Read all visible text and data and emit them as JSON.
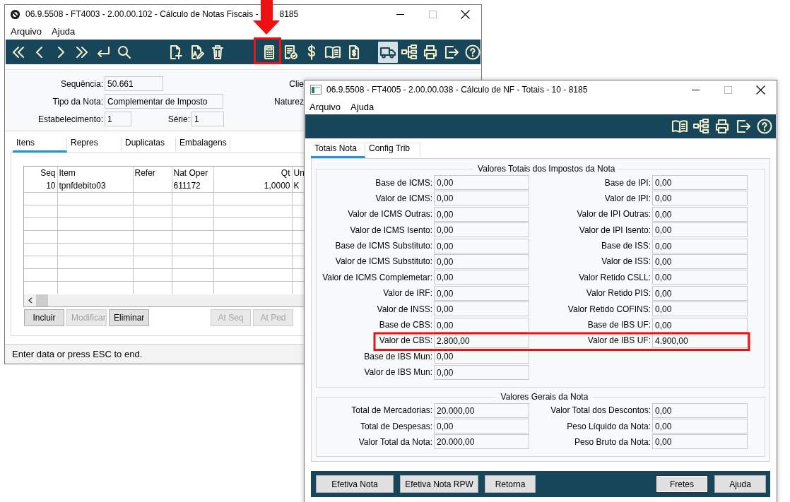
{
  "back_window": {
    "title": "06.9.5508 - FT4003 - 2.00.00.102 - Cálculo de Notas Fiscais -",
    "title_end": "8185",
    "menu": [
      "Arquivo",
      "Ajuda"
    ],
    "toolbar": [
      {
        "pressed": false
      },
      {
        "pressed": false
      },
      {
        "pressed": false
      },
      {
        "pressed": false
      },
      {
        "pressed": false
      },
      {
        "pressed": false
      },
      {
        "pressed": false
      },
      {
        "pressed": false
      },
      {
        "pressed": false
      },
      {
        "pressed": false
      },
      {
        "pressed": false
      },
      {
        "pressed": false
      },
      {
        "pressed": false
      },
      {
        "pressed": false
      },
      {
        "pressed": true
      },
      {
        "pressed": false
      },
      {
        "pressed": false
      },
      {
        "pressed": false
      },
      {
        "pressed": false
      }
    ],
    "form": {
      "sequencia": {
        "label": "Sequência:",
        "value": "50.661"
      },
      "tipo": {
        "label": "Tipo da Nota:",
        "value": "Complementar de Imposto"
      },
      "estabelecimento": {
        "label": "Estabelecimento:",
        "value": "1"
      },
      "serie": {
        "label": "Série:",
        "value": "1"
      },
      "cut_labels": [
        "Clie",
        "Naturez"
      ]
    },
    "tabs": [
      {
        "label": "Itens",
        "selected": true
      },
      {
        "label": "Repres",
        "selected": false
      },
      {
        "label": "Duplicatas",
        "selected": false
      },
      {
        "label": "Embalagens",
        "selected": false
      }
    ],
    "table": {
      "columns": [
        "Seq",
        "Item",
        "Refer",
        "Nat Oper",
        "Qt",
        "Un"
      ],
      "rows": [
        [
          "10",
          "tpnfdebito03",
          null,
          "611172",
          "1,0000",
          "K"
        ]
      ]
    },
    "buttons": [
      {
        "label": "Incluir",
        "disabled": false
      },
      {
        "label": "Modificar",
        "disabled": true
      },
      {
        "label": "Eliminar",
        "disabled": false
      }
    ],
    "buttons_right": [
      {
        "label": "At Seq",
        "disabled": true
      },
      {
        "label": "At Ped",
        "disabled": true
      }
    ],
    "status_bar": "Enter data or press ESC to end."
  },
  "front_window": {
    "title": "06.9.5508 - FT4005 - 2.00.00.038 - Cálculo de NF - Totais - 10 - 8185",
    "menu": [
      "Arquivo",
      "Ajuda"
    ],
    "tabs": [
      {
        "label": "Totais Nota",
        "selected": true
      },
      {
        "label": "Config Trib",
        "selected": false
      }
    ],
    "tax_group": {
      "title": "Valores Totais dos Impostos da Nota",
      "left": [
        {
          "label": "Base de ICMS:",
          "value": "0,00"
        },
        {
          "label": "Valor de ICMS:",
          "value": "0,00"
        },
        {
          "label": "Valor de ICMS Outras:",
          "value": "0,00"
        },
        {
          "label": "Valor de ICMS Isento:",
          "value": "0,00"
        },
        {
          "label": "Base de ICMS Substituto:",
          "value": "0,00"
        },
        {
          "label": "Valor de ICMS Substituto:",
          "value": "0,00"
        },
        {
          "label": "Valor de ICMS Complemetar:",
          "value": "0,00"
        },
        {
          "label": "Valor de IRF:",
          "value": "0,00"
        },
        {
          "label": "Valor de INSS:",
          "value": "0,00"
        },
        {
          "label": "Base de CBS:",
          "value": "0,00"
        },
        {
          "label": "Valor de CBS:",
          "value": "2.800,00"
        },
        {
          "label": "Base de IBS Mun:",
          "value": "0,00"
        },
        {
          "label": "Valor de IBS Mun:",
          "value": "0,00"
        }
      ],
      "right": [
        {
          "label": "Base de IPI:",
          "value": "0,00"
        },
        {
          "label": "Valor de IPI:",
          "value": "0,00"
        },
        {
          "label": "Valor de IPI Outras:",
          "value": "0,00"
        },
        {
          "label": "Valor de IPI Isento:",
          "value": "0,00"
        },
        {
          "label": "Base de ISS:",
          "value": "0,00"
        },
        {
          "label": "Valor de ISS:",
          "value": "0,00"
        },
        {
          "label": "Valor Retido CSLL:",
          "value": "0,00"
        },
        {
          "label": "Valor Retido PIS:",
          "value": "0,00"
        },
        {
          "label": "Valor Retido COFINS:",
          "value": "0,00"
        },
        {
          "label": "Base de IBS UF:",
          "value": "0,00"
        },
        {
          "label": "Valor de IBS UF:",
          "value": "4.900,00"
        }
      ]
    },
    "general_group": {
      "title": "Valores Gerais da Nota",
      "left": [
        {
          "label": "Total de Mercadorias:",
          "value": "20.000,00"
        },
        {
          "label": "Total de Despesas:",
          "value": "0,00"
        },
        {
          "label": "Valor Total da Nota:",
          "value": "20.000,00"
        }
      ],
      "right": [
        {
          "label": "Valor Total dos Descontos:",
          "value": "0,00"
        },
        {
          "label": "Peso Líquido da Nota:",
          "value": "0,00"
        },
        {
          "label": "Peso Bruto da Nota:",
          "value": "0,00"
        }
      ]
    },
    "buttons_left": [
      {
        "label": "Efetiva Nota",
        "focused": false
      },
      {
        "label": "Efetiva Nota RPW",
        "focused": false
      },
      {
        "label": "Retorna",
        "focused": false
      }
    ],
    "buttons_right": [
      {
        "label": "Fretes",
        "focused": true
      },
      {
        "label": "Ajuda",
        "focused": false
      }
    ]
  }
}
